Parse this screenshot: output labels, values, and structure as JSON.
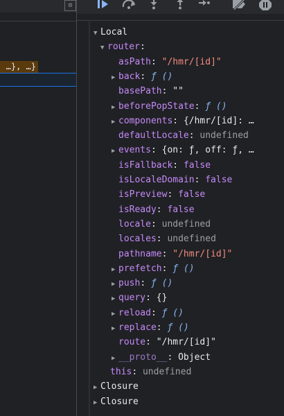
{
  "left": {
    "highlighted_text": "…}, …}",
    "toolbar_button_glyph": "⊡"
  },
  "toolbar": {
    "icons": [
      "resume-icon",
      "step-over-icon",
      "step-into-icon",
      "step-out-icon",
      "step-icon",
      "deactivate-breakpoints-icon",
      "pause-on-exceptions-icon"
    ]
  },
  "scope": {
    "local_label": "Local",
    "router_label": "router",
    "props": [
      {
        "name": "asPath",
        "value": "\"/hmr/[id]\"",
        "kind": "string",
        "expandable": false
      },
      {
        "name": "back",
        "value": "ƒ ()",
        "kind": "function",
        "expandable": true
      },
      {
        "name": "basePath",
        "value": "\"\"",
        "kind": "string-plain",
        "expandable": false
      },
      {
        "name": "beforePopState",
        "value": "ƒ ()",
        "kind": "function",
        "expandable": true
      },
      {
        "name": "components",
        "value": "{/hmr/[id]: …",
        "kind": "object",
        "expandable": true
      },
      {
        "name": "defaultLocale",
        "value": "undefined",
        "kind": "undefined",
        "expandable": false
      },
      {
        "name": "events",
        "value": "{on: ƒ, off: ƒ, …",
        "kind": "object",
        "expandable": true
      },
      {
        "name": "isFallback",
        "value": "false",
        "kind": "boolean",
        "expandable": false
      },
      {
        "name": "isLocaleDomain",
        "value": "false",
        "kind": "boolean",
        "expandable": false
      },
      {
        "name": "isPreview",
        "value": "false",
        "kind": "boolean",
        "expandable": false
      },
      {
        "name": "isReady",
        "value": "false",
        "kind": "boolean",
        "expandable": false
      },
      {
        "name": "locale",
        "value": "undefined",
        "kind": "undefined",
        "expandable": false
      },
      {
        "name": "locales",
        "value": "undefined",
        "kind": "undefined",
        "expandable": false
      },
      {
        "name": "pathname",
        "value": "\"/hmr/[id]\"",
        "kind": "string",
        "expandable": false
      },
      {
        "name": "prefetch",
        "value": "ƒ ()",
        "kind": "function",
        "expandable": true
      },
      {
        "name": "push",
        "value": "ƒ ()",
        "kind": "function",
        "expandable": true
      },
      {
        "name": "query",
        "value": "{}",
        "kind": "object",
        "expandable": true
      },
      {
        "name": "reload",
        "value": "ƒ ()",
        "kind": "function",
        "expandable": true
      },
      {
        "name": "replace",
        "value": "ƒ ()",
        "kind": "function",
        "expandable": true
      },
      {
        "name": "route",
        "value": "\"/hmr/[id]\"",
        "kind": "string-plain",
        "expandable": false
      },
      {
        "name": "__proto__",
        "value": "Object",
        "kind": "object",
        "expandable": true
      }
    ],
    "this_label": "this",
    "this_value": "undefined",
    "closure_1": "Closure",
    "closure_2": "Closure"
  }
}
